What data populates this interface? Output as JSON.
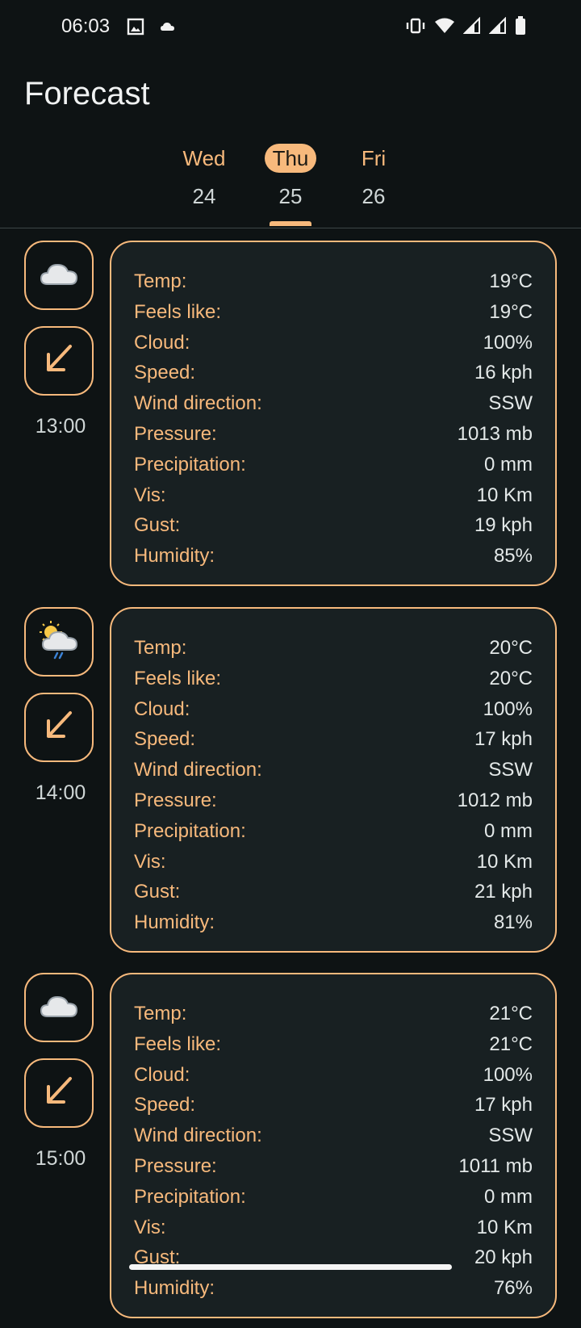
{
  "status_bar": {
    "time": "06:03",
    "icons": [
      "image-icon",
      "cloud-icon",
      "vibrate-icon",
      "wifi-icon",
      "signal-icon",
      "signal-icon-2",
      "battery-icon"
    ]
  },
  "header": {
    "title": "Forecast"
  },
  "day_tabs": [
    {
      "name": "Wed",
      "date": "24",
      "selected": false
    },
    {
      "name": "Thu",
      "date": "25",
      "selected": true
    },
    {
      "name": "Fri",
      "date": "26",
      "selected": false
    }
  ],
  "colors": {
    "accent": "#f7b97c",
    "background": "#0e1314",
    "card": "#182022"
  },
  "forecast": [
    {
      "hour": "13:00",
      "weather_icon": "cloud-icon",
      "wind_icon": "arrow-down-left-icon",
      "rows": [
        {
          "label": "Temp:",
          "value": "19°C"
        },
        {
          "label": "Feels like:",
          "value": "19°C"
        },
        {
          "label": "Cloud:",
          "value": "100%"
        },
        {
          "label": "Speed:",
          "value": "16 kph"
        },
        {
          "label": "Wind direction:",
          "value": "SSW"
        },
        {
          "label": "Pressure:",
          "value": "1013 mb"
        },
        {
          "label": "Precipitation:",
          "value": "0 mm"
        },
        {
          "label": "Vis:",
          "value": "10 Km"
        },
        {
          "label": "Gust:",
          "value": "19 kph"
        },
        {
          "label": "Humidity:",
          "value": "85%"
        }
      ]
    },
    {
      "hour": "14:00",
      "weather_icon": "sun-cloud-rain-icon",
      "wind_icon": "arrow-down-left-icon",
      "rows": [
        {
          "label": "Temp:",
          "value": "20°C"
        },
        {
          "label": "Feels like:",
          "value": "20°C"
        },
        {
          "label": "Cloud:",
          "value": "100%"
        },
        {
          "label": "Speed:",
          "value": "17 kph"
        },
        {
          "label": "Wind direction:",
          "value": "SSW"
        },
        {
          "label": "Pressure:",
          "value": "1012 mb"
        },
        {
          "label": "Precipitation:",
          "value": "0 mm"
        },
        {
          "label": "Vis:",
          "value": "10 Km"
        },
        {
          "label": "Gust:",
          "value": "21 kph"
        },
        {
          "label": "Humidity:",
          "value": "81%"
        }
      ]
    },
    {
      "hour": "15:00",
      "weather_icon": "cloud-icon",
      "wind_icon": "arrow-down-left-icon",
      "rows": [
        {
          "label": "Temp:",
          "value": "21°C"
        },
        {
          "label": "Feels like:",
          "value": "21°C"
        },
        {
          "label": "Cloud:",
          "value": "100%"
        },
        {
          "label": "Speed:",
          "value": "17 kph"
        },
        {
          "label": "Wind direction:",
          "value": "SSW"
        },
        {
          "label": "Pressure:",
          "value": "1011 mb"
        },
        {
          "label": "Precipitation:",
          "value": "0 mm"
        },
        {
          "label": "Vis:",
          "value": "10 Km"
        },
        {
          "label": "Gust:",
          "value": "20 kph"
        },
        {
          "label": "Humidity:",
          "value": "76%"
        }
      ]
    }
  ]
}
